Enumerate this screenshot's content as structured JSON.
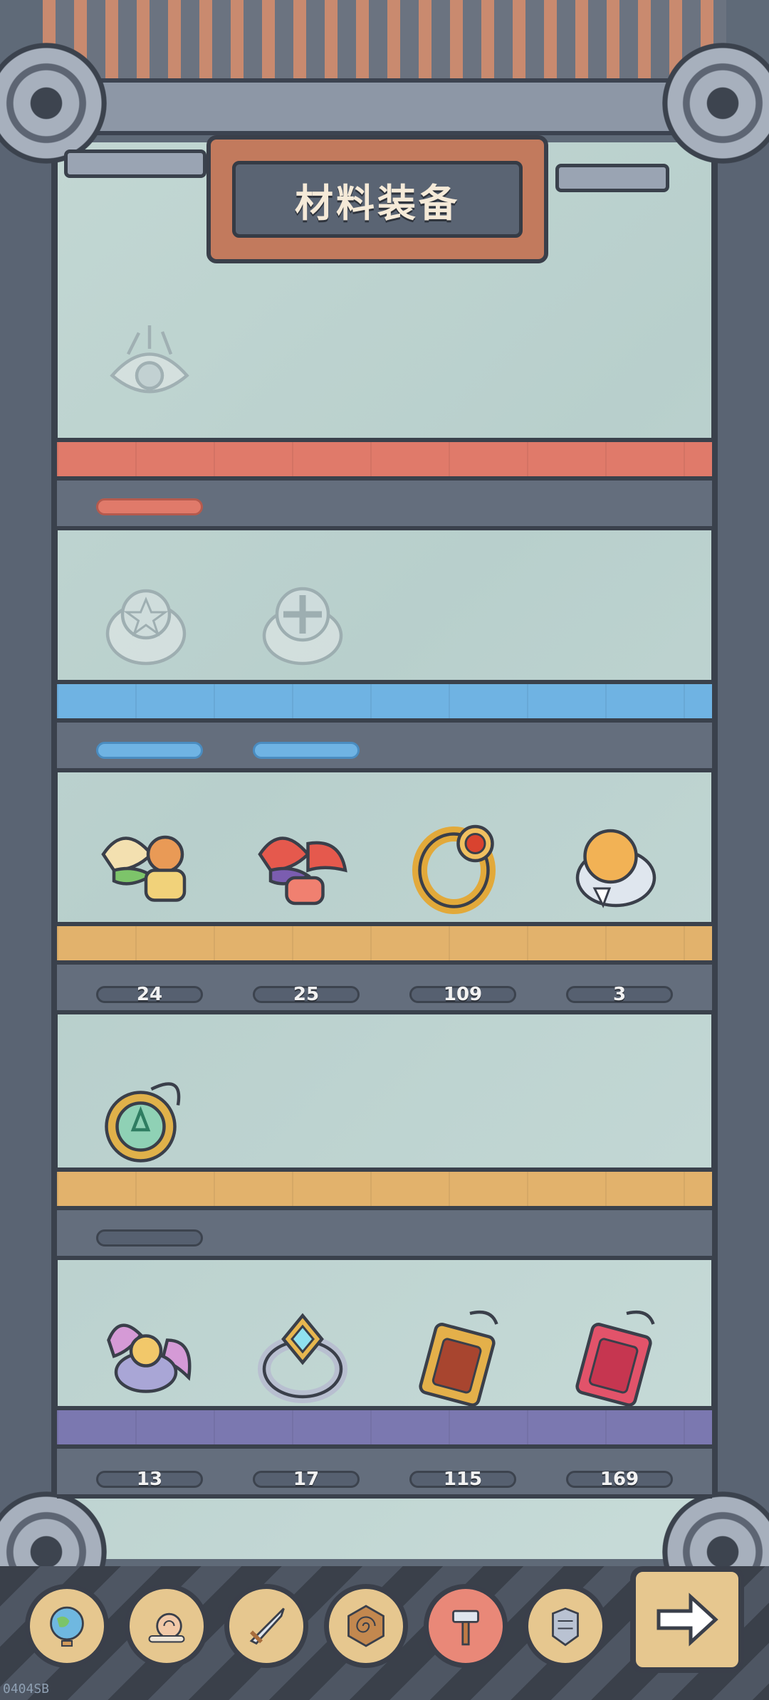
{
  "header": {
    "title": "材料装备"
  },
  "shelves": [
    {
      "color": "#e07a6a",
      "items": [
        {
          "name": "eye-emblem",
          "count": null,
          "locked": true
        }
      ]
    },
    {
      "color": "#6fb3e3",
      "items": [
        {
          "name": "star-ring",
          "count": null,
          "locked": true
        },
        {
          "name": "cross-ring",
          "count": null,
          "locked": true
        }
      ]
    },
    {
      "color": "#e2b26c",
      "items": [
        {
          "name": "wing-gauntlet-green",
          "count": "24",
          "locked": false
        },
        {
          "name": "wing-gauntlet-red",
          "count": "25",
          "locked": false
        },
        {
          "name": "ruby-gold-ring",
          "count": "109",
          "locked": false
        },
        {
          "name": "orb-silver-ring",
          "count": "3",
          "locked": false
        }
      ]
    },
    {
      "color": "#e2b26c",
      "items": [
        {
          "name": "green-gem-amulet",
          "count": null,
          "locked": false
        }
      ]
    },
    {
      "color": "#7b78b0",
      "items": [
        {
          "name": "purple-wing-ring",
          "count": "13",
          "locked": false
        },
        {
          "name": "crescent-gem-ring",
          "count": "17",
          "locked": false
        },
        {
          "name": "gold-tag-charm",
          "count": "115",
          "locked": false
        },
        {
          "name": "red-tag-charm",
          "count": "169",
          "locked": false
        }
      ]
    }
  ],
  "toolbar": {
    "buttons": [
      "globe-icon",
      "snail-icon",
      "swords-icon",
      "spiral-shield-icon",
      "hammer-icon",
      "armor-icon"
    ],
    "active_index": 4
  },
  "footer": {
    "version": "0404SB"
  }
}
